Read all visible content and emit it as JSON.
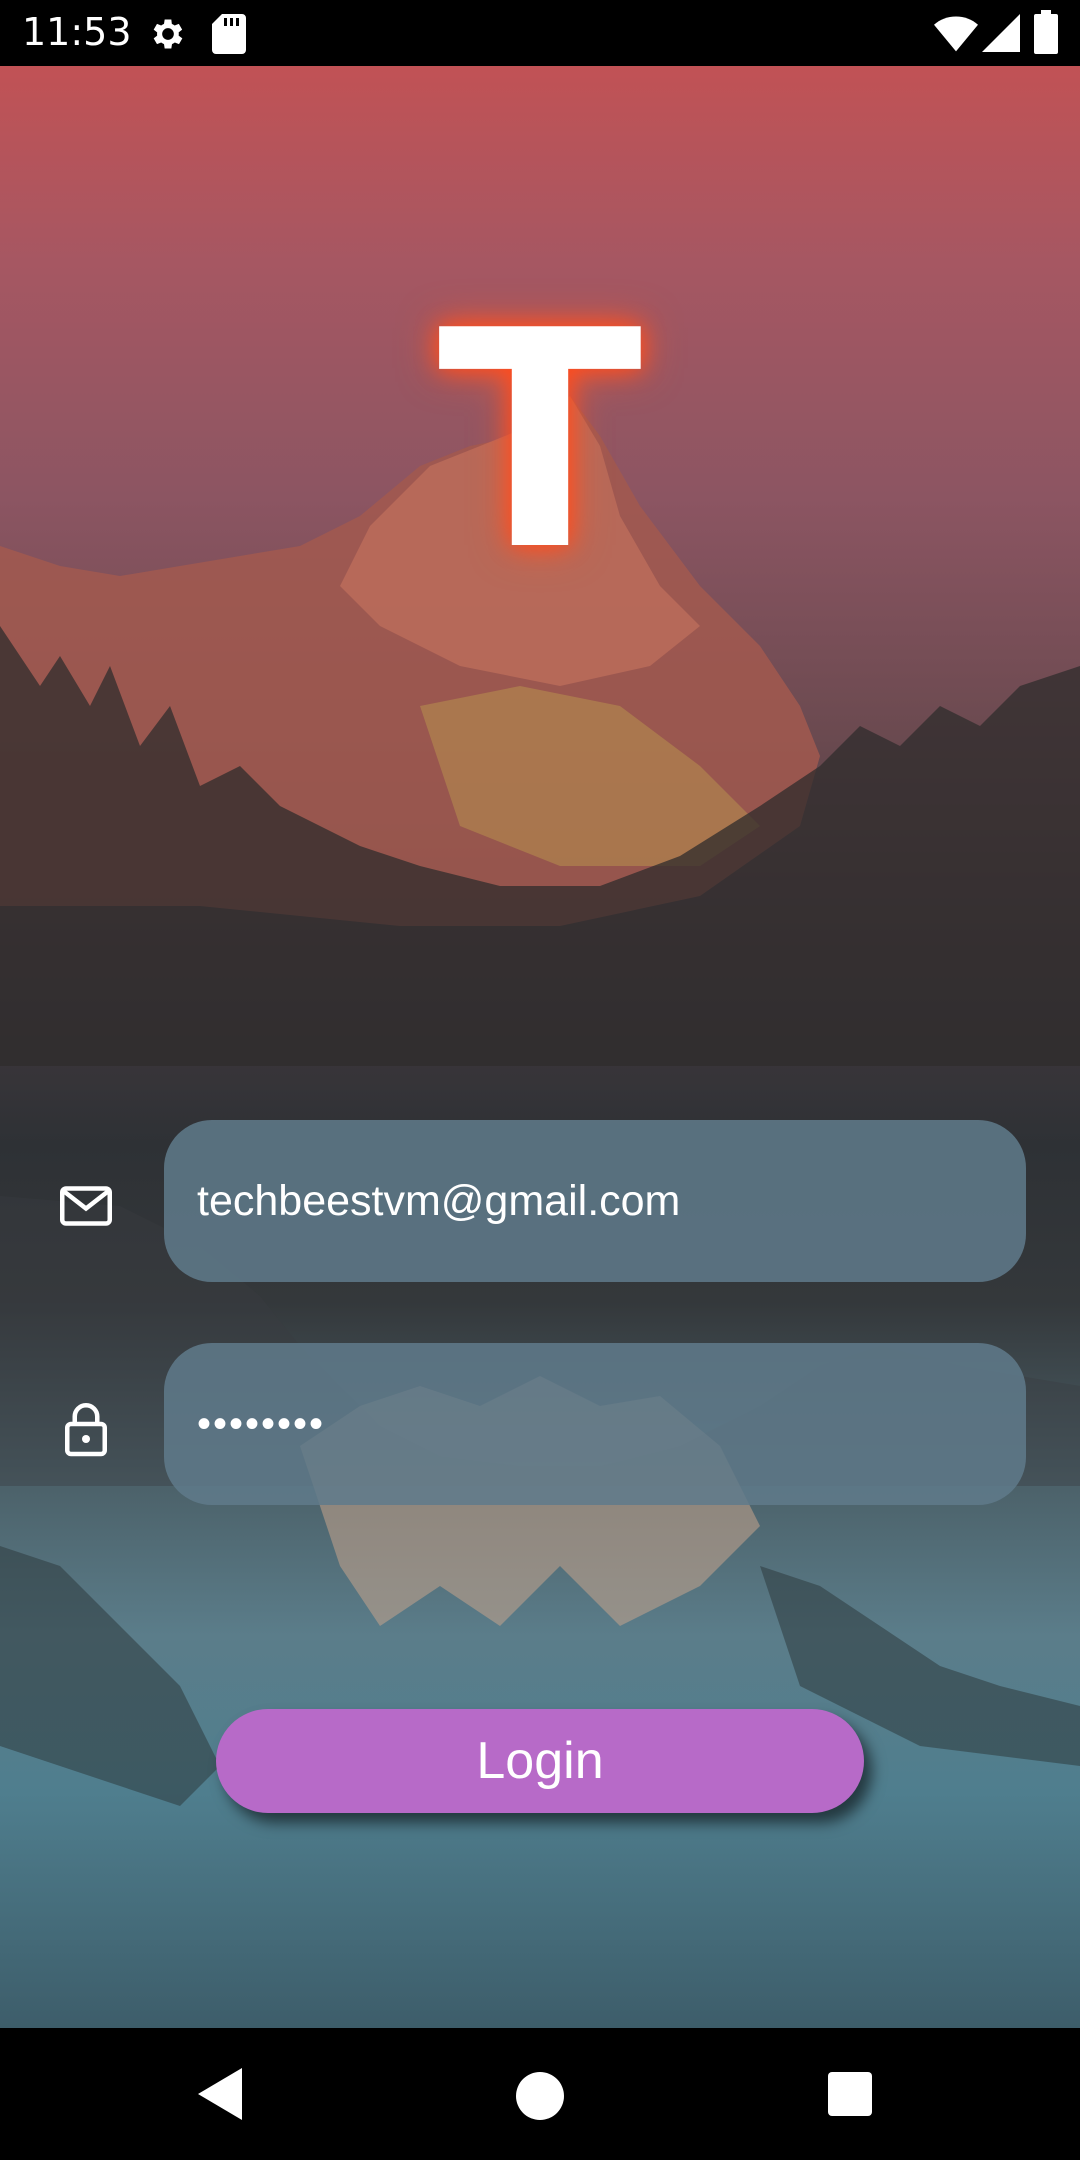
{
  "status_bar": {
    "time": "11:53"
  },
  "app": {
    "logo_letter": "T"
  },
  "form": {
    "email_value": "techbeestvm@gmail.com",
    "password_value": "••••••••",
    "login_label": "Login"
  },
  "colors": {
    "login_button": "#b76ac8",
    "field_background": "#607a8a",
    "logo_glow": "#ff4a1c"
  },
  "icons": {
    "status": [
      "settings-icon",
      "sd-card-icon",
      "wifi-icon",
      "signal-icon",
      "battery-icon"
    ],
    "fields": [
      "mail-icon",
      "lock-icon"
    ],
    "navigation": [
      "back-icon",
      "home-icon",
      "recents-icon"
    ]
  }
}
